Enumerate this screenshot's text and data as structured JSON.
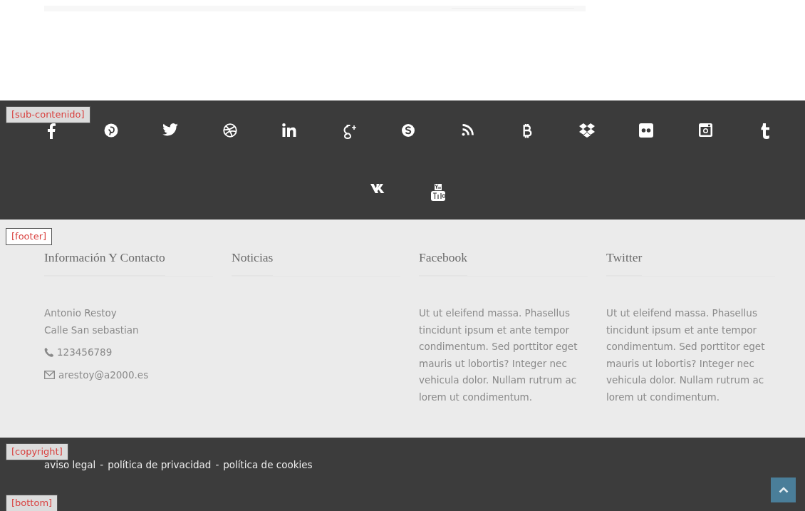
{
  "social_band": {
    "tag": "[sub-contenido]",
    "icons": [
      {
        "kind": "facebook"
      },
      {
        "kind": "pinterest"
      },
      {
        "kind": "twitter"
      },
      {
        "kind": "dribbble"
      },
      {
        "kind": "linkedin"
      },
      {
        "kind": "googleplus"
      },
      {
        "kind": "skype"
      },
      {
        "kind": "rss"
      },
      {
        "kind": "bitcoin"
      },
      {
        "kind": "dropbox"
      },
      {
        "kind": "flickr"
      },
      {
        "kind": "instagram"
      },
      {
        "kind": "tumblr"
      },
      {
        "kind": "vk"
      },
      {
        "kind": "youtube"
      }
    ]
  },
  "footer": {
    "tag": "[footer]",
    "columns": [
      {
        "heading": "Información Y Contacto",
        "lines": [
          {
            "kind": "plain",
            "text": "Antonio Restoy"
          },
          {
            "kind": "plain",
            "text": "Calle San sebastian"
          },
          {
            "kind": "phone",
            "text": "123456789"
          },
          {
            "kind": "email",
            "text": "arestoy@a2000.es"
          }
        ]
      },
      {
        "heading": "Noticias"
      },
      {
        "heading": "Facebook",
        "text": "Ut ut eleifend massa. Phasellus tincidunt ipsum et ante tempor condimentum. Sed porttitor eget mauris ut lobortis? Integer nec vehicula dolor. Nullam rutrum ac lorem ut condimentum."
      },
      {
        "heading": "Twitter",
        "text": "Ut ut eleifend massa. Phasellus tincidunt ipsum et ante tempor condimentum. Sed porttitor eget mauris ut lobortis? Integer nec vehicula dolor. Nullam rutrum ac lorem ut condimentum."
      }
    ]
  },
  "copyright": {
    "tag": "[copyright]",
    "links": [
      "aviso legal",
      "política de privacidad",
      "política de cookies"
    ],
    "separator": "-"
  },
  "bottom": {
    "tag": "[bottom]"
  }
}
